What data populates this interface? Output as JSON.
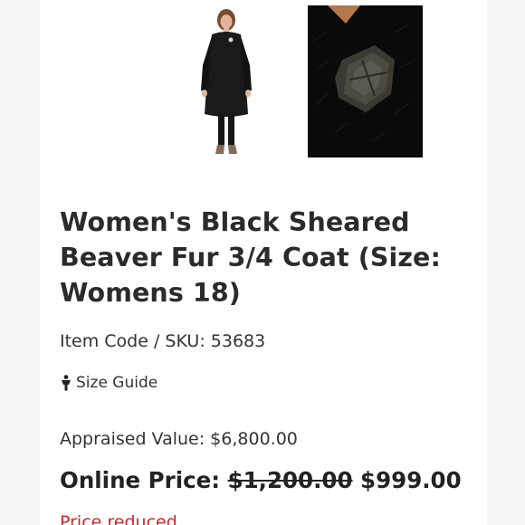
{
  "product": {
    "title": "Women's Black Sheared Beaver Fur 3/4 Coat (Size: Womens 18)",
    "sku_label": "Item Code / SKU:",
    "sku_value": "53683",
    "size_guide_label": "Size Guide",
    "size_guide_icon": "person-icon",
    "appraised_label": "Appraised Value:",
    "appraised_value": "$6,800.00",
    "online_price_label": "Online Price:",
    "original_price": "$1,200.00",
    "sale_price": "$999.00",
    "partial_link_text": "Price reduced"
  },
  "colors": {
    "accent_red": "#d0252b",
    "text": "#2b2b2b"
  }
}
